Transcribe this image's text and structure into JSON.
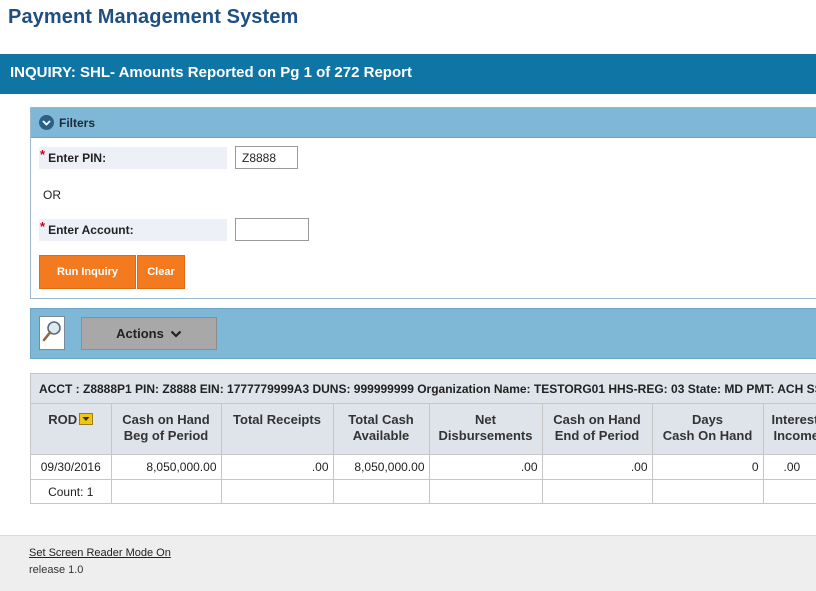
{
  "app": {
    "title": "Payment Management System"
  },
  "banner": {
    "title": "INQUIRY: SHL- Amounts Reported on Pg 1 of 272 Report"
  },
  "filters": {
    "header": "Filters",
    "pin_label": "Enter PIN:",
    "pin_value": "Z8888",
    "or_text": "OR",
    "account_label": "Enter Account:",
    "account_value": "",
    "run_label": "Run Inquiry",
    "clear_label": "Clear"
  },
  "toolbar": {
    "actions_label": "Actions"
  },
  "grid": {
    "acct_line": "ACCT : Z8888P1 PIN: Z8888 EIN: 1777779999A3 DUNS: 999999999 Organization Name: TESTORG01 HHS-REG: 03 State: MD PMT: ACH SS",
    "columns": [
      {
        "line1": "ROD",
        "line2": ""
      },
      {
        "line1": "Cash on Hand",
        "line2": "Beg of Period"
      },
      {
        "line1": "Total Receipts",
        "line2": ""
      },
      {
        "line1": "Total Cash",
        "line2": "Available"
      },
      {
        "line1": "Net",
        "line2": "Disbursements"
      },
      {
        "line1": "Cash on Hand",
        "line2": "End of Period"
      },
      {
        "line1": "Days",
        "line2": "Cash On Hand"
      },
      {
        "line1": "Interest",
        "line2": "Income"
      }
    ],
    "rows": [
      [
        "09/30/2016",
        "8,050,000.00",
        ".00",
        "8,050,000.00",
        ".00",
        ".00",
        "0",
        ".00"
      ],
      [
        "Count: 1",
        "",
        "",
        "",
        "",
        "",
        "",
        ""
      ]
    ]
  },
  "footer": {
    "screen_reader_link": "Set Screen Reader Mode On",
    "release": "release 1.0"
  },
  "colors": {
    "title": "#1f4f82",
    "banner": "#0f75a4",
    "panel_header": "#7fb8d6",
    "button_orange": "#f47a1f",
    "required_marker": "#d0021b"
  },
  "icons": {
    "filters_toggle": "chevron-down-circle-icon",
    "search": "magnifier-icon",
    "actions": "chevron-down-icon",
    "sort": "sort-dropdown-icon"
  }
}
